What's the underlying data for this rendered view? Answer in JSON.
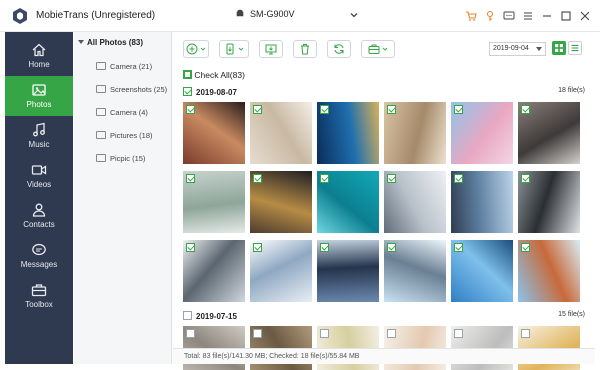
{
  "app": {
    "title": "MobieTrans (Unregistered)"
  },
  "device": {
    "name": "SM-G900V"
  },
  "window_controls": [
    "cart-icon",
    "key-icon",
    "feedback-icon",
    "menu-icon",
    "minimize-icon",
    "maximize-icon",
    "close-icon"
  ],
  "sidebar": {
    "items": [
      {
        "label": "Home",
        "icon": "home-icon",
        "active": false
      },
      {
        "label": "Photos",
        "icon": "photos-icon",
        "active": true
      },
      {
        "label": "Music",
        "icon": "music-icon",
        "active": false
      },
      {
        "label": "Videos",
        "icon": "videos-icon",
        "active": false
      },
      {
        "label": "Contacts",
        "icon": "contacts-icon",
        "active": false
      },
      {
        "label": "Messages",
        "icon": "messages-icon",
        "active": false
      },
      {
        "label": "Toolbox",
        "icon": "toolbox-icon",
        "active": false
      }
    ]
  },
  "folders": {
    "header": "All Photos (83)",
    "items": [
      {
        "label": "Camera (21)"
      },
      {
        "label": "Screenshots (25)"
      },
      {
        "label": "Camera (4)"
      },
      {
        "label": "Pictures (18)"
      },
      {
        "label": "Picpic (15)"
      }
    ]
  },
  "toolbar": {
    "buttons": [
      "add-icon",
      "export-to-device-icon",
      "export-to-pc-icon",
      "delete-icon",
      "refresh-icon",
      "toolbox-more-icon"
    ]
  },
  "date_filter": {
    "value": "2019-09-04"
  },
  "check_all": {
    "label": "Check All(83)"
  },
  "groups": [
    {
      "date": "2019-08-07",
      "count": "18 file(s)",
      "checked": true,
      "photos": [
        {
          "colors": [
            "#7a3c2c",
            "#c98a62",
            "#2a1d1a"
          ],
          "checked": true
        },
        {
          "colors": [
            "#e6dccf",
            "#c9b9a3",
            "#f3eee7"
          ],
          "checked": true
        },
        {
          "colors": [
            "#0a2c5a",
            "#1f6fae",
            "#d9b15a"
          ],
          "checked": true
        },
        {
          "colors": [
            "#d8c3a5",
            "#a58a6a",
            "#ede1cf"
          ],
          "checked": true
        },
        {
          "colors": [
            "#8ec4ea",
            "#e9a7c2",
            "#f4d6e2"
          ],
          "checked": true
        },
        {
          "colors": [
            "#8a7f78",
            "#3d3a3a",
            "#d4d0cc"
          ],
          "checked": true
        },
        {
          "colors": [
            "#c7d3cd",
            "#8ea59a",
            "#e5ebe7"
          ],
          "checked": true
        },
        {
          "colors": [
            "#1f1e24",
            "#b68c45",
            "#4c3c2f"
          ],
          "checked": true
        },
        {
          "colors": [
            "#12a9b8",
            "#0b7f8f",
            "#6fd7e0"
          ],
          "checked": true
        },
        {
          "colors": [
            "#eef1f4",
            "#b7c0c9",
            "#5f6b78"
          ],
          "checked": true
        },
        {
          "colors": [
            "#bcd3ea",
            "#5e7fa0",
            "#2f3e52"
          ],
          "checked": true
        },
        {
          "colors": [
            "#dfe3e6",
            "#2b2f33",
            "#8a9096"
          ],
          "checked": true
        },
        {
          "colors": [
            "#cfd7de",
            "#5b6670",
            "#f0f2f4"
          ],
          "checked": true
        },
        {
          "colors": [
            "#e8eef4",
            "#8fa8c2",
            "#ffffff"
          ],
          "checked": true
        },
        {
          "colors": [
            "#6d8ab0",
            "#24344c",
            "#c5d3e2"
          ],
          "checked": true
        },
        {
          "colors": [
            "#c9e2f2",
            "#6a7f93",
            "#eef6fb"
          ],
          "checked": true
        },
        {
          "colors": [
            "#2f7fc5",
            "#7fc0ec",
            "#1b4e7c"
          ],
          "checked": true
        },
        {
          "colors": [
            "#8cc3ea",
            "#c86a3a",
            "#d9ecf8"
          ],
          "checked": true
        }
      ]
    },
    {
      "date": "2019-07-15",
      "count": "15 file(s)",
      "checked": false,
      "photos": [
        {
          "colors": [
            "#cfcac2",
            "#8d877e"
          ],
          "checked": false
        },
        {
          "colors": [
            "#b09a7a",
            "#6b5a44"
          ],
          "checked": false
        },
        {
          "colors": [
            "#f2efe3",
            "#d7cf9e"
          ],
          "checked": false
        },
        {
          "colors": [
            "#f6f2ea",
            "#e3c9b0"
          ],
          "checked": false
        },
        {
          "colors": [
            "#eeeeec",
            "#bdbdbd"
          ],
          "checked": false
        },
        {
          "colors": [
            "#f7f1e2",
            "#e0b35a"
          ],
          "checked": false
        }
      ]
    }
  ],
  "status": {
    "text": "Total: 83 file(s)/141.30 MB; Checked: 18 file(s)/55.84 MB"
  },
  "colors": {
    "accent": "#35a545",
    "sidebar": "#2f3a50"
  }
}
